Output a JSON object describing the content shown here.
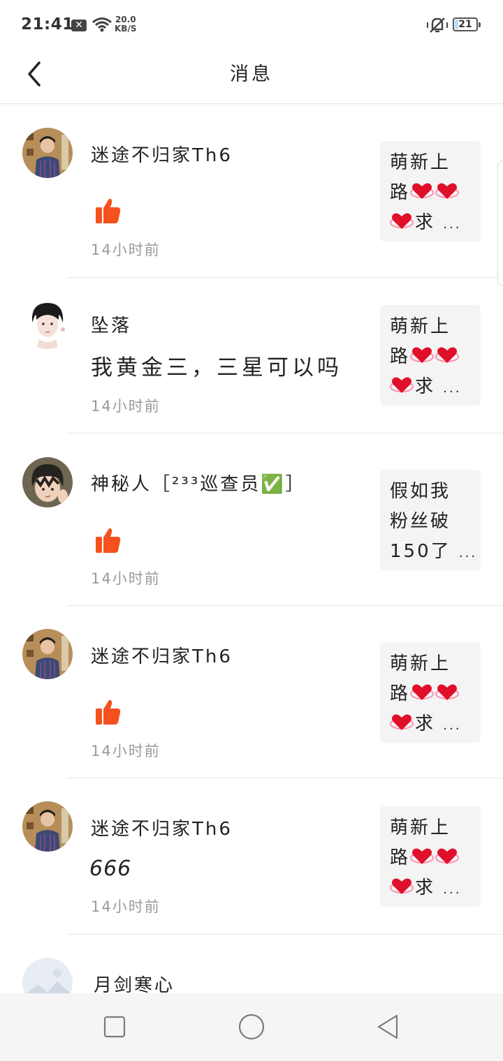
{
  "status_bar": {
    "time": "21:41",
    "notification_icon": "close-box-icon",
    "speed_value": "20.0",
    "speed_unit": "KB/S",
    "battery": "21"
  },
  "header": {
    "title": "消息",
    "back_icon": "chevron-left-icon"
  },
  "colors": {
    "accent_thumb": "#f4511e",
    "preview_bg": "#f4f4f4",
    "time_text": "#9a9a9a"
  },
  "messages": [
    {
      "name": "迷途不归家Th6",
      "content_type": "like",
      "content_icon": "thumbs-up-icon",
      "time": "14小时前",
      "preview": {
        "line1": "萌新上",
        "line2_text": "路",
        "line3_text": "求",
        "ellipsis": "..."
      }
    },
    {
      "name": "坠落",
      "content_type": "text",
      "content": "我黄金三，三星可以吗",
      "time": "14小时前",
      "preview": {
        "line1": "萌新上",
        "line2_text": "路",
        "line3_text": "求",
        "ellipsis": "..."
      }
    },
    {
      "name": "神秘人［²³³巡查员✅］",
      "content_type": "like",
      "content_icon": "thumbs-up-icon",
      "time": "14小时前",
      "preview": {
        "line1": "假如我",
        "line2_text": "粉丝破",
        "line3_text": "150了",
        "ellipsis": "..."
      }
    },
    {
      "name": "迷途不归家Th6",
      "content_type": "like",
      "content_icon": "thumbs-up-icon",
      "time": "14小时前",
      "preview": {
        "line1": "萌新上",
        "line2_text": "路",
        "line3_text": "求",
        "ellipsis": "..."
      }
    },
    {
      "name": "迷途不归家Th6",
      "content_type": "text",
      "content": "666",
      "time": "14小时前",
      "preview": {
        "line1": "萌新上",
        "line2_text": "路",
        "line3_text": "求",
        "ellipsis": "..."
      }
    },
    {
      "name": "月剑寒心"
    }
  ],
  "nav_bar": {
    "recent_icon": "square-icon",
    "home_icon": "circle-icon",
    "back_icon": "triangle-back-icon"
  }
}
